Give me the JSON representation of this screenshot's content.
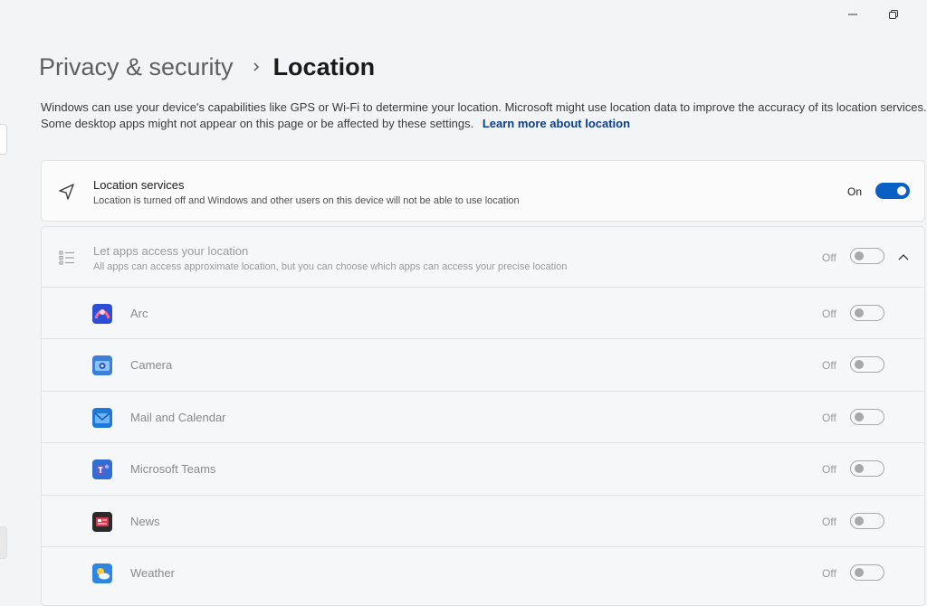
{
  "window": {
    "minimize_icon": "minimize-icon",
    "restore_icon": "restore-icon"
  },
  "breadcrumb": {
    "parent": "Privacy & security",
    "current": "Location"
  },
  "description": {
    "text": "Windows can use your device's capabilities like GPS or Wi-Fi to determine your location. Microsoft might use location data to improve the accuracy of its location services. Some desktop apps might not appear on this page or be affected by these settings.",
    "link": "Learn more about location"
  },
  "location_services": {
    "title": "Location services",
    "subtitle": "Location is turned off and Windows and other users on this device will not be able to use location",
    "state_label": "On",
    "on": true
  },
  "app_access": {
    "title": "Let apps access your location",
    "subtitle": "All apps can access approximate location, but you can choose which apps can access your precise location",
    "state_label": "Off",
    "on": false,
    "expanded": true
  },
  "apps": [
    {
      "name": "Arc",
      "state_label": "Off",
      "color": "#2c4fd6"
    },
    {
      "name": "Camera",
      "state_label": "Off",
      "color": "#3b7fd9"
    },
    {
      "name": "Mail and Calendar",
      "state_label": "Off",
      "color": "#1e7ad6"
    },
    {
      "name": "Microsoft Teams",
      "state_label": "Off",
      "color": "#2f6fd4"
    },
    {
      "name": "News",
      "state_label": "Off",
      "color": "#2a2a2a"
    },
    {
      "name": "Weather",
      "state_label": "Off",
      "color": "#2f86e0"
    }
  ],
  "colors": {
    "accent": "#0a5fc4",
    "link": "#0a3e8c"
  }
}
